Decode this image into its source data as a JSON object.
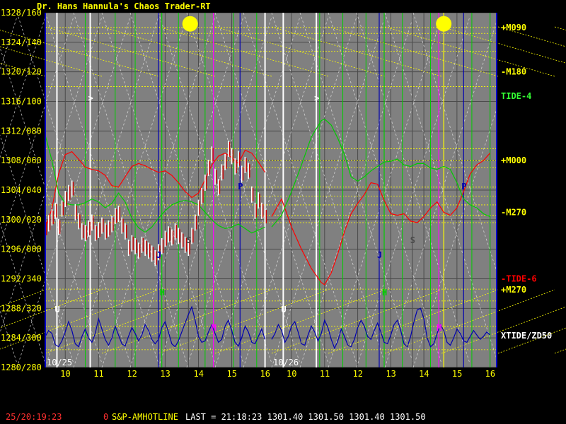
{
  "title": "Dr. Hans Hannula's Chaos Trader-RT",
  "colors": {
    "panel": "#808080",
    "grid": "#4a4a4a",
    "yellow": "#ffff00",
    "white": "#ffffff",
    "green": "#00cc00",
    "blue": "#0000b0",
    "magenta": "#ff00ff",
    "red": "#ff0000",
    "bright_green": "#33ff33"
  },
  "chart_data": {
    "type": "line",
    "title": "Dr. Hans Hannula's Chaos Trader-RT",
    "y_axis_left": {
      "ylim": [
        1280,
        1328
      ],
      "ticks": [
        {
          "value": 1328,
          "label": "1328/160"
        },
        {
          "value": 1324,
          "label": "1324/140"
        },
        {
          "value": 1320,
          "label": "1320/120"
        },
        {
          "value": 1316,
          "label": "1316/100"
        },
        {
          "value": 1312,
          "label": "1312/080"
        },
        {
          "value": 1308,
          "label": "1308/060"
        },
        {
          "value": 1304,
          "label": "1304/040"
        },
        {
          "value": 1300,
          "label": "1300/020"
        },
        {
          "value": 1296,
          "label": "1296/000"
        },
        {
          "value": 1292,
          "label": "1292/340"
        },
        {
          "value": 1288,
          "label": "1288/320"
        },
        {
          "value": 1284,
          "label": "1284/300"
        },
        {
          "value": 1280,
          "label": "1280/280"
        }
      ]
    },
    "x_axis": {
      "xlim": [
        9.4,
        16.2
      ],
      "ticks": [
        {
          "x": 10,
          "label": "10"
        },
        {
          "x": 11,
          "label": "11"
        },
        {
          "x": 12,
          "label": "12"
        },
        {
          "x": 13,
          "label": "13"
        },
        {
          "x": 14,
          "label": "14"
        },
        {
          "x": 15,
          "label": "15"
        },
        {
          "x": 16,
          "label": "16"
        }
      ],
      "day_labels": [
        "10/25",
        "10/26"
      ]
    },
    "right_labels": [
      {
        "text": "+M090",
        "y": 1326,
        "color": "yellow"
      },
      {
        "text": "-M180",
        "y": 1320,
        "color": "yellow"
      },
      {
        "text": "TIDE-4",
        "y": 1316.7,
        "color": "bright_green"
      },
      {
        "text": "+M000",
        "y": 1308,
        "color": "yellow"
      },
      {
        "text": "-M270",
        "y": 1301,
        "color": "yellow"
      },
      {
        "text": "-TIDE-6",
        "y": 1292,
        "color": "red"
      },
      {
        "text": "+M270",
        "y": 1290.5,
        "color": "yellow"
      },
      {
        "text": "XTIDE/ZD50",
        "y": 1284.3,
        "color": "white"
      }
    ],
    "vertical_markers": [
      {
        "day": 0,
        "x": 9.75,
        "color": "white",
        "label": "U"
      },
      {
        "day": 0,
        "x": 10.75,
        "color": "white",
        "label": ">"
      },
      {
        "day": 0,
        "x": 12.8,
        "color": "blue",
        "label": "J"
      },
      {
        "day": 0,
        "x": 12.9,
        "color": "green",
        "label": "H"
      },
      {
        "day": 0,
        "x": 13.7,
        "color": "gray",
        "label": "S"
      },
      {
        "day": 0,
        "x": 14.45,
        "color": "magenta",
        "label": "M"
      },
      {
        "day": 0,
        "x": 15.25,
        "color": "blue",
        "label": "P"
      },
      {
        "day": 0,
        "x": 16.0,
        "color": "white",
        "label": ""
      },
      {
        "day": 1,
        "x": 9.75,
        "color": "white",
        "label": "U"
      },
      {
        "day": 1,
        "x": 10.75,
        "color": "white",
        "label": ">"
      },
      {
        "day": 1,
        "x": 12.65,
        "color": "blue",
        "label": "J"
      },
      {
        "day": 1,
        "x": 12.8,
        "color": "green",
        "label": "H"
      },
      {
        "day": 1,
        "x": 13.65,
        "color": "gray",
        "label": "S"
      },
      {
        "day": 1,
        "x": 14.45,
        "color": "magenta",
        "label": "M"
      },
      {
        "day": 1,
        "x": 14.6,
        "color": "yellow",
        "label": ""
      },
      {
        "day": 1,
        "x": 15.2,
        "color": "blue",
        "label": "P"
      }
    ],
    "suns": [
      {
        "day": 0,
        "x": 13.75,
        "y": 1326.5
      },
      {
        "day": 1,
        "x": 14.6,
        "y": 1326.5
      }
    ],
    "series": [
      {
        "name": "price",
        "color": "white",
        "day": 0,
        "x": [
          9.4,
          9.5,
          9.6,
          9.7,
          9.8,
          9.9,
          10.0,
          10.1,
          10.2,
          10.3,
          10.4,
          10.5,
          10.6,
          10.7,
          10.8,
          10.9,
          11.0,
          11.1,
          11.2,
          11.3,
          11.4,
          11.5,
          11.6,
          11.7,
          11.8,
          11.9,
          12.0,
          12.1,
          12.2,
          12.3,
          12.4,
          12.5,
          12.6,
          12.7,
          12.8,
          12.9,
          13.0,
          13.1,
          13.2,
          13.3,
          13.4,
          13.5,
          13.6,
          13.7,
          13.8,
          13.9,
          14.0,
          14.1,
          14.2,
          14.3,
          14.4,
          14.5,
          14.6,
          14.7,
          14.8,
          14.9,
          15.0,
          15.1,
          15.2,
          15.3,
          15.4,
          15.5,
          15.6,
          15.7,
          15.8,
          15.9,
          16.0
        ],
        "values": [
          1298.8,
          1299.5,
          1300.3,
          1301.2,
          1299.0,
          1301.5,
          1302.8,
          1303.6,
          1304.2,
          1301.0,
          1299.8,
          1298.4,
          1298.2,
          1298.8,
          1299.6,
          1298.2,
          1298.6,
          1299.2,
          1298.4,
          1298.8,
          1299.4,
          1300.5,
          1300.8,
          1299.2,
          1298.4,
          1296.2,
          1296.8,
          1296.4,
          1295.8,
          1296.6,
          1296.2,
          1295.8,
          1295.4,
          1294.8,
          1295.6,
          1296.4,
          1297.4,
          1298.0,
          1297.6,
          1298.4,
          1297.8,
          1297.2,
          1296.6,
          1296.2,
          1297.8,
          1299.6,
          1301.6,
          1303.2,
          1305.0,
          1307.0,
          1308.8,
          1305.8,
          1304.4,
          1306.4,
          1307.8,
          1309.6,
          1308.6,
          1307.2,
          1308.2,
          1306.2,
          1307.4,
          1306.6,
          1303.4,
          1301.2,
          1302.6,
          1301.2,
          1300.4
        ]
      },
      {
        "name": "red",
        "color": "red",
        "day": 0,
        "x": [
          9.4,
          9.6,
          9.8,
          10.0,
          10.2,
          10.4,
          10.6,
          10.8,
          11.0,
          11.2,
          11.4,
          11.6,
          11.8,
          12.0,
          12.2,
          12.4,
          12.6,
          12.8,
          13.0,
          13.2,
          13.4,
          13.6,
          13.8,
          14.0,
          14.2,
          14.4,
          14.6,
          14.8,
          15.0,
          15.2,
          15.4,
          15.6,
          15.8,
          16.0
        ],
        "values": [
          1298.8,
          1301.5,
          1306.2,
          1308.8,
          1309.2,
          1308.2,
          1307.1,
          1306.8,
          1306.6,
          1306.0,
          1304.6,
          1304.4,
          1305.8,
          1307.2,
          1307.6,
          1307.3,
          1306.8,
          1306.4,
          1306.6,
          1306.0,
          1305.0,
          1303.8,
          1303.0,
          1303.6,
          1305.4,
          1307.4,
          1308.6,
          1309.0,
          1308.4,
          1307.6,
          1309.4,
          1309.0,
          1307.8,
          1306.4
        ]
      },
      {
        "name": "red",
        "color": "red",
        "day": 1,
        "x": [
          9.4,
          9.7,
          10.0,
          10.3,
          10.6,
          10.9,
          11.0,
          11.2,
          11.4,
          11.6,
          11.8,
          12.0,
          12.2,
          12.4,
          12.6,
          12.8,
          13.0,
          13.2,
          13.4,
          13.6,
          13.8,
          14.0,
          14.2,
          14.4,
          14.6,
          14.8,
          15.0,
          15.2,
          15.4,
          15.6,
          15.8,
          16.0
        ],
        "values": [
          1300.4,
          1302.8,
          1299.0,
          1296.0,
          1293.4,
          1291.5,
          1291.2,
          1292.8,
          1295.4,
          1298.4,
          1300.8,
          1302.2,
          1303.4,
          1305.0,
          1304.8,
          1302.6,
          1300.8,
          1300.6,
          1300.8,
          1299.8,
          1299.6,
          1300.4,
          1301.6,
          1302.4,
          1301.0,
          1300.6,
          1301.6,
          1303.8,
          1306.2,
          1307.4,
          1308.0,
          1309.0
        ]
      },
      {
        "name": "TIDE-4",
        "color": "green",
        "day": 0,
        "x": [
          9.4,
          9.6,
          9.8,
          10.0,
          10.2,
          10.4,
          10.6,
          10.8,
          11.0,
          11.2,
          11.4,
          11.6,
          11.8,
          12.0,
          12.2,
          12.4,
          12.6,
          12.8,
          13.0,
          13.2,
          13.4,
          13.6,
          13.8,
          14.0,
          14.2,
          14.4,
          14.6,
          14.8,
          15.0,
          15.2,
          15.4,
          15.6,
          15.8,
          16.0
        ],
        "values": [
          1311.4,
          1308.0,
          1303.6,
          1302.2,
          1302.0,
          1302.0,
          1302.3,
          1302.8,
          1302.4,
          1301.6,
          1302.2,
          1303.6,
          1302.4,
          1300.2,
          1298.9,
          1298.3,
          1299.0,
          1300.2,
          1301.2,
          1302.0,
          1302.4,
          1302.6,
          1302.4,
          1302.0,
          1301.0,
          1300.0,
          1299.2,
          1298.8,
          1299.0,
          1299.4,
          1298.8,
          1298.2,
          1298.6,
          1299.0
        ]
      },
      {
        "name": "TIDE-4",
        "color": "green",
        "day": 1,
        "x": [
          9.4,
          9.7,
          10.0,
          10.3,
          10.6,
          10.9,
          11.0,
          11.2,
          11.4,
          11.6,
          11.8,
          12.0,
          12.2,
          12.4,
          12.6,
          12.8,
          13.0,
          13.2,
          13.4,
          13.6,
          13.8,
          14.0,
          14.2,
          14.4,
          14.6,
          14.8,
          15.0,
          15.2,
          15.4,
          15.6,
          15.8,
          16.0
        ],
        "values": [
          1299.0,
          1300.6,
          1303.8,
          1307.4,
          1311.2,
          1313.4,
          1313.6,
          1312.8,
          1311.0,
          1308.8,
          1305.8,
          1305.2,
          1305.8,
          1306.6,
          1307.2,
          1307.8,
          1307.9,
          1308.2,
          1307.4,
          1307.2,
          1307.6,
          1307.6,
          1307.0,
          1306.8,
          1307.2,
          1306.8,
          1305.0,
          1302.8,
          1302.0,
          1301.6,
          1300.8,
          1300.4
        ]
      },
      {
        "name": "XTIDE/ZD50",
        "color": "blue",
        "day": 0,
        "x": [
          9.4,
          9.5,
          9.6,
          9.7,
          9.8,
          9.9,
          10.0,
          10.1,
          10.2,
          10.3,
          10.4,
          10.5,
          10.6,
          10.7,
          10.8,
          10.9,
          11.0,
          11.1,
          11.2,
          11.3,
          11.4,
          11.5,
          11.6,
          11.7,
          11.8,
          11.9,
          12.0,
          12.1,
          12.2,
          12.3,
          12.4,
          12.5,
          12.6,
          12.7,
          12.8,
          12.9,
          13.0,
          13.1,
          13.2,
          13.3,
          13.4,
          13.5,
          13.6,
          13.7,
          13.8,
          13.9,
          14.0,
          14.1,
          14.2,
          14.3,
          14.4,
          14.5,
          14.6,
          14.7,
          14.8,
          14.9,
          15.0,
          15.1,
          15.2,
          15.3,
          15.4,
          15.5,
          15.6,
          15.7,
          15.8,
          15.9,
          16.0
        ],
        "values": [
          1284.2,
          1285.0,
          1284.6,
          1283.1,
          1282.8,
          1283.6,
          1284.8,
          1286.2,
          1285.0,
          1283.2,
          1282.8,
          1284.2,
          1285.2,
          1284.0,
          1283.4,
          1284.6,
          1286.6,
          1285.2,
          1283.8,
          1283.0,
          1284.0,
          1285.6,
          1284.4,
          1283.2,
          1282.9,
          1284.2,
          1285.4,
          1284.6,
          1283.6,
          1284.4,
          1285.8,
          1285.0,
          1283.8,
          1283.2,
          1283.8,
          1285.4,
          1286.2,
          1284.8,
          1283.2,
          1282.8,
          1283.6,
          1284.8,
          1286.0,
          1287.2,
          1288.2,
          1286.4,
          1284.2,
          1283.4,
          1283.6,
          1284.8,
          1285.8,
          1284.6,
          1283.4,
          1283.8,
          1285.6,
          1286.4,
          1285.0,
          1283.4,
          1282.9,
          1284.0,
          1285.6,
          1284.8,
          1283.4,
          1283.2,
          1284.2,
          1285.2,
          1283.8
        ]
      },
      {
        "name": "XTIDE/ZD50",
        "color": "blue",
        "day": 1,
        "x": [
          9.4,
          9.5,
          9.6,
          9.7,
          9.8,
          9.9,
          10.0,
          10.1,
          10.2,
          10.3,
          10.4,
          10.5,
          10.6,
          10.7,
          10.8,
          10.9,
          11.0,
          11.1,
          11.2,
          11.3,
          11.4,
          11.5,
          11.6,
          11.7,
          11.8,
          11.9,
          12.0,
          12.1,
          12.2,
          12.3,
          12.4,
          12.5,
          12.6,
          12.7,
          12.8,
          12.9,
          13.0,
          13.1,
          13.2,
          13.3,
          13.4,
          13.5,
          13.6,
          13.7,
          13.8,
          13.9,
          14.0,
          14.1,
          14.2,
          14.3,
          14.4,
          14.5,
          14.6,
          14.7,
          14.8,
          14.9,
          15.0,
          15.1,
          15.2,
          15.3,
          15.4,
          15.5,
          15.6,
          15.7,
          15.8,
          15.9,
          16.0
        ],
        "values": [
          1283.8,
          1284.6,
          1285.8,
          1285.0,
          1283.4,
          1284.2,
          1285.6,
          1286.2,
          1284.8,
          1283.2,
          1283.0,
          1284.4,
          1285.6,
          1284.8,
          1283.6,
          1284.6,
          1286.4,
          1285.4,
          1283.8,
          1282.6,
          1283.6,
          1285.2,
          1284.2,
          1283.0,
          1282.8,
          1283.8,
          1285.4,
          1286.4,
          1285.6,
          1284.2,
          1283.8,
          1285.0,
          1286.0,
          1284.8,
          1283.4,
          1283.2,
          1284.4,
          1285.8,
          1286.4,
          1285.0,
          1283.2,
          1282.8,
          1284.2,
          1286.2,
          1287.8,
          1288.0,
          1286.6,
          1284.0,
          1282.8,
          1283.2,
          1284.6,
          1285.8,
          1285.0,
          1283.4,
          1283.0,
          1284.0,
          1285.2,
          1284.6,
          1283.6,
          1283.4,
          1284.2,
          1285.0,
          1284.4,
          1283.8,
          1284.2,
          1284.8,
          1284.4
        ]
      }
    ]
  },
  "status_bar": {
    "timestamp": "25/20:19:23",
    "channel": "0",
    "symbol": "S&P-AMHOTLINE",
    "quote": "LAST = 21:18:23 1301.40 1301.50 1301.40 1301.50"
  }
}
